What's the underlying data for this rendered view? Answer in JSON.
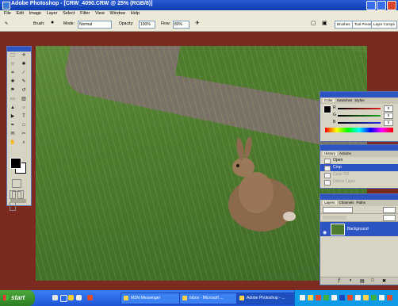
{
  "window": {
    "title": "Adobe Photoshop - [CRW_4090.CRW @ 25% (RGB/8)]"
  },
  "menu": [
    "File",
    "Edit",
    "Image",
    "Layer",
    "Select",
    "Filter",
    "View",
    "Window",
    "Help"
  ],
  "options": {
    "brush_label": "Brush:",
    "mode_label": "Mode:",
    "mode_value": "Normal",
    "opacity_label": "Opacity:",
    "opacity_value": "100%",
    "flow_label": "Flow:",
    "flow_value": "80%",
    "palette_tabs": [
      "Brushes",
      "Tool Presets",
      "Layer Comps"
    ]
  },
  "color_panel": {
    "tabs": [
      "Color",
      "Swatches",
      "Styles"
    ],
    "rows": [
      {
        "label": "R",
        "value": "0"
      },
      {
        "label": "G",
        "value": "0"
      },
      {
        "label": "B",
        "value": "0"
      }
    ],
    "bar_colors": [
      "#e02020",
      "#20a020",
      "#2030e0"
    ]
  },
  "history_panel": {
    "tabs": [
      "History",
      "Actions"
    ],
    "items": [
      {
        "label": "Open",
        "state": "normal"
      },
      {
        "label": "Crop",
        "state": "selected"
      },
      {
        "label": "Color Fill",
        "state": "dim"
      },
      {
        "label": "Delete Layer",
        "state": "dim"
      }
    ]
  },
  "layers_panel": {
    "tabs": [
      "Layers",
      "Channels",
      "Paths"
    ],
    "layer_name": "Background"
  },
  "taskbar": {
    "start": "start",
    "buttons": [
      {
        "label": "MSN Messenger",
        "active": false
      },
      {
        "label": "Inbox - Microsoft ...",
        "active": false
      },
      {
        "label": "Adobe Photoshop - ...",
        "active": true
      }
    ]
  },
  "colors": {
    "accent": "#2d55c2",
    "canvas_border": "#7a2a1e"
  }
}
